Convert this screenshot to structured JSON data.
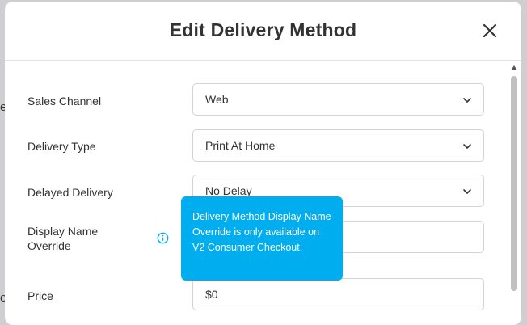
{
  "background": {
    "letter_top": "e",
    "letter_bottom": "e"
  },
  "modal": {
    "title": "Edit Delivery Method",
    "close_icon": "close-icon"
  },
  "form": {
    "sales_channel": {
      "label": "Sales Channel",
      "value": "Web"
    },
    "delivery_type": {
      "label": "Delivery Type",
      "value": "Print At Home"
    },
    "delayed_delivery": {
      "label": "Delayed Delivery",
      "value": "No Delay"
    },
    "display_name_override": {
      "label_line1": "Display Name",
      "label_line2": "Override",
      "value": "",
      "info_icon": "info-icon"
    },
    "price": {
      "label": "Price",
      "value": "$0"
    }
  },
  "tooltip": {
    "text": "Delivery Method Display Name Override is only available on V2 Consumer Checkout."
  },
  "colors": {
    "tooltip_bg": "#00aef0",
    "info_icon": "#00aef0",
    "title": "#333333"
  }
}
